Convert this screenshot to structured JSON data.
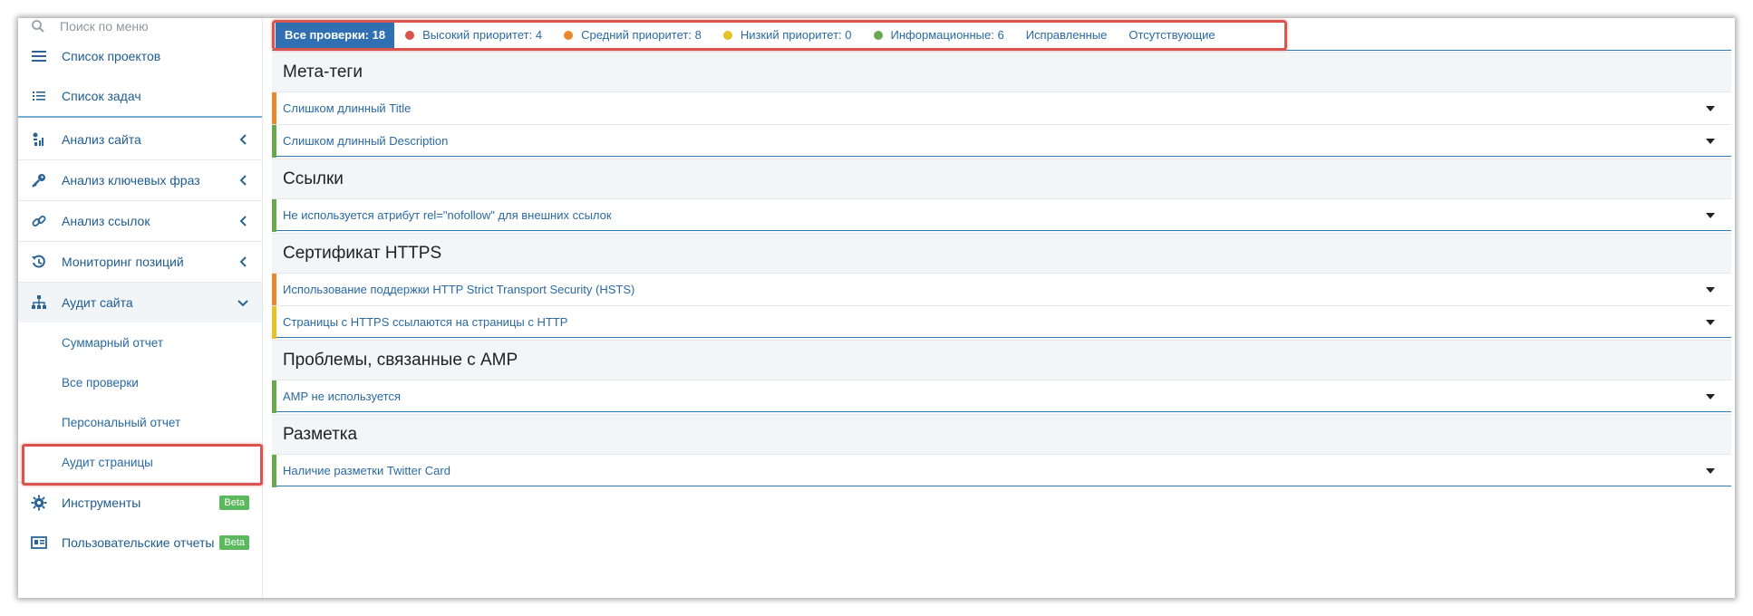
{
  "search": {
    "placeholder": "Поиск по меню"
  },
  "sidebar": {
    "top_items": [
      {
        "label": "Список проектов",
        "icon": "bars-icon"
      },
      {
        "label": "Список задач",
        "icon": "list-icon"
      }
    ],
    "sections": [
      {
        "label": "Анализ сайта",
        "icon": "site-analysis-icon",
        "expanded": false
      },
      {
        "label": "Анализ ключевых фраз",
        "icon": "key-icon",
        "expanded": false
      },
      {
        "label": "Анализ ссылок",
        "icon": "link-icon",
        "expanded": false
      },
      {
        "label": "Мониторинг позиций",
        "icon": "history-icon",
        "expanded": false
      },
      {
        "label": "Аудит сайта",
        "icon": "sitemap-icon",
        "expanded": true
      }
    ],
    "audit_sub_items": [
      {
        "label": "Суммарный отчет"
      },
      {
        "label": "Все проверки"
      },
      {
        "label": "Персональный отчет"
      },
      {
        "label": "Аудит страницы",
        "highlighted": true
      }
    ],
    "tools": {
      "label": "Инструменты",
      "badge": "Beta",
      "icon": "gear-icon"
    },
    "custom_reports": {
      "label": "Пользовательские отчеты",
      "badge": "Beta",
      "icon": "report-card-icon"
    }
  },
  "filters": {
    "all": "Все проверки: 18",
    "high": "Высокий приоритет: 4",
    "medium": "Средний приоритет: 8",
    "low": "Низкий приоритет: 0",
    "info": "Информационные: 6",
    "fixed": "Исправленные",
    "missing": "Отсутствующие"
  },
  "colors": {
    "accent": "#2f6fb2",
    "high": "#d9534f",
    "medium": "#e8892b",
    "low": "#e6c229",
    "info": "#6aa84f",
    "highlight_border": "#d9534f"
  },
  "groups": [
    {
      "title": "Мета-теги",
      "items": [
        {
          "label": "Слишком длинный Title",
          "priority": "medium"
        },
        {
          "label": "Слишком длинный Description",
          "priority": "info"
        }
      ]
    },
    {
      "title": "Ссылки",
      "items": [
        {
          "label": "Не используется атрибут rel=\"nofollow\" для внешних ссылок",
          "priority": "info"
        }
      ]
    },
    {
      "title": "Сертификат HTTPS",
      "items": [
        {
          "label": "Использование поддержки HTTP Strict Transport Security (HSTS)",
          "priority": "medium"
        },
        {
          "label": "Страницы с HTTPS ссылаются на страницы с HTTP",
          "priority": "low"
        }
      ]
    },
    {
      "title": "Проблемы, связанные с AMP",
      "items": [
        {
          "label": "AMP не используется",
          "priority": "info"
        }
      ]
    },
    {
      "title": "Разметка",
      "items": [
        {
          "label": "Наличие разметки Twitter Card",
          "priority": "info"
        }
      ]
    }
  ]
}
